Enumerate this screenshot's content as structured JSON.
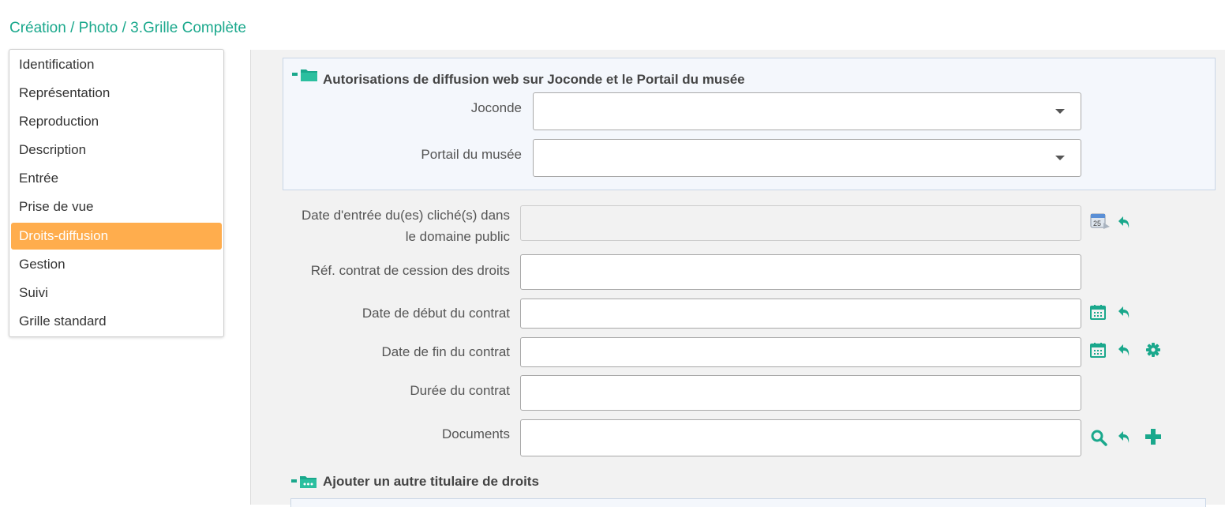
{
  "breadcrumb": "Création / Photo / 3.Grille Complète",
  "sidebar": {
    "items": [
      {
        "label": "Identification"
      },
      {
        "label": "Représentation"
      },
      {
        "label": "Reproduction"
      },
      {
        "label": "Description"
      },
      {
        "label": "Entrée"
      },
      {
        "label": "Prise de vue"
      },
      {
        "label": "Droits-diffusion",
        "active": true
      },
      {
        "label": "Gestion"
      },
      {
        "label": "Suivi"
      },
      {
        "label": "Grille standard"
      }
    ]
  },
  "section_web": {
    "title": "Autorisations de diffusion web sur Joconde et le Portail du musée",
    "joconde_label": "Joconde",
    "joconde_value": "",
    "portail_label": "Portail du musée",
    "portail_value": ""
  },
  "fields": {
    "date_entree_label_1": "Date d'entrée du(es) cliché(s) dans",
    "date_entree_label_2": "le domaine public",
    "date_entree_value": "",
    "ref_contrat_label": "Réf. contrat de cession des droits",
    "ref_contrat_value": "",
    "date_debut_label": "Date de début du contrat",
    "date_debut_value": "",
    "date_fin_label": "Date de fin du contrat",
    "date_fin_value": "",
    "duree_label": "Durée du contrat",
    "duree_value": "",
    "documents_label": "Documents",
    "documents_value": ""
  },
  "section_titulaire": {
    "title": "Ajouter un autre titulaire de droits"
  },
  "colors": {
    "accent": "#1aa88c",
    "active_item": "#ffad4d"
  },
  "icons": [
    "folder-icon",
    "calendar-25-icon",
    "calendar-icon",
    "undo-icon",
    "gear-icon",
    "search-icon",
    "plus-icon"
  ]
}
